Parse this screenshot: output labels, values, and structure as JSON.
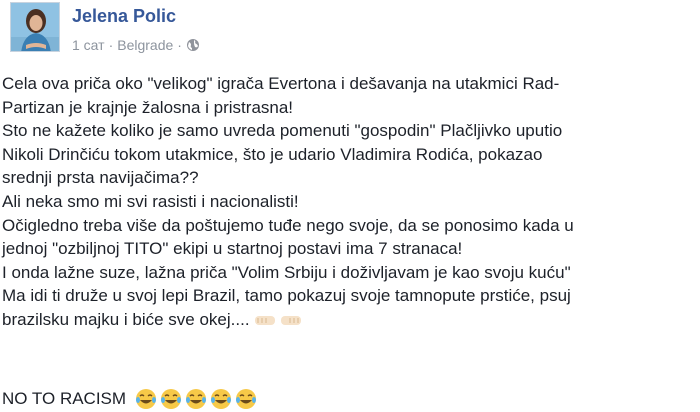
{
  "post": {
    "author": "Jelena Polic",
    "time": "1 сат",
    "separator": "·",
    "location": "Belgrade",
    "icons": {
      "avatar": "profile-photo",
      "audience": "globe-icon",
      "reaction": "fist-bump-emoji",
      "laugh": "tears-of-joy-emoji"
    },
    "lines": [
      "Cela ova priča oko \"velikog\" igrača Evertona i dešavanja na utakmici Rad-",
      "Partizan je krajnje žalosna i pristrasna!",
      "Sto ne kažete koliko je samo uvreda pomenuti \"gospodin\" Plačljivko uputio",
      "Nikoli Drinčiću tokom utakmice, što je udario Vladimira Rodića, pokazao",
      "srednji prsta navijačima??",
      "Ali neka smo mi svi rasisti i nacionalisti!",
      "Očigledno treba više da poštujemo tuđe nego svoje, da se ponosimo kada u",
      "jednoj \"ozbiljnoj TITO\" ekipi u startnoj postavi ima 7 stranaca!",
      "I onda lažne suze, lažna priča \"Volim Srbiju i doživljavam je kao svoju kuću\"",
      "Ma idi ti druže u svoj lepi Brazil, tamo pokazuj svoje tamnopute prstiće, psuj",
      "brazilsku majku i biće sve okej...."
    ],
    "footer": "NO TO RACISM"
  }
}
